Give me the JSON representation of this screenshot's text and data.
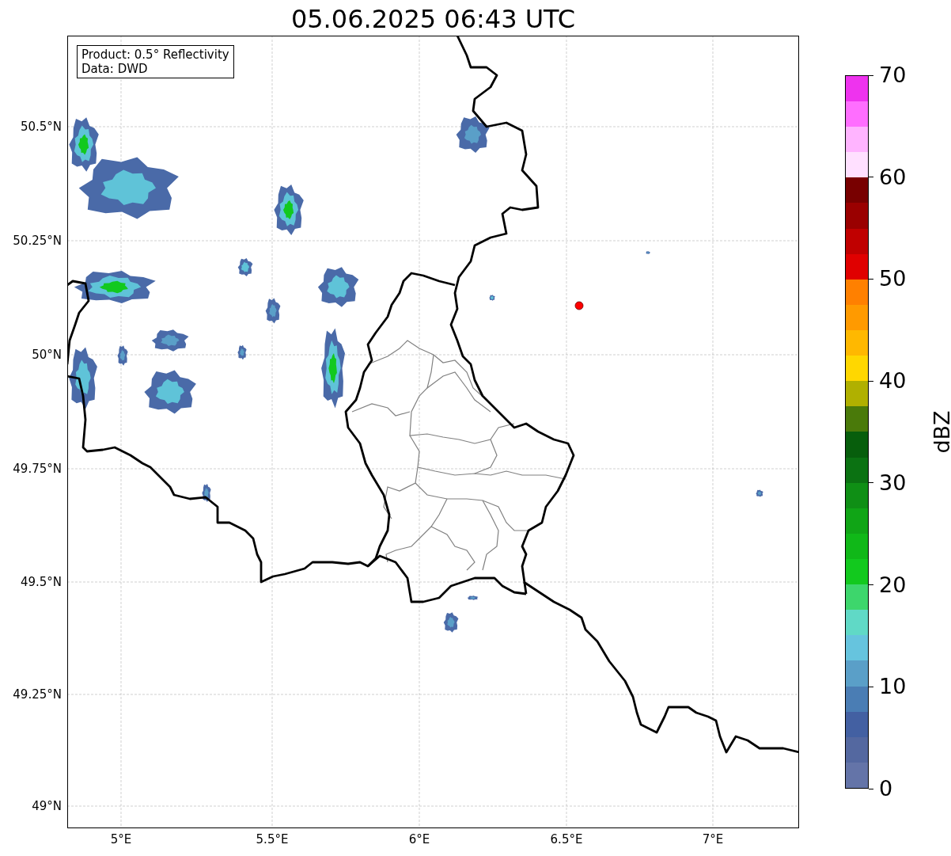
{
  "title": "05.06.2025 06:43 UTC",
  "info_box": {
    "lines": [
      "Product: 0.5° Reflectivity",
      "Data: DWD"
    ]
  },
  "map": {
    "latitude_labels": [
      "50.5°N",
      "50.25°N",
      "50°N",
      "49.75°N",
      "49.5°N",
      "49.25°N",
      "49°N"
    ],
    "longitude_labels": [
      "5°E",
      "5.5°E",
      "6°E",
      "6.5°E",
      "7°E"
    ]
  },
  "colorbar": {
    "label": "dBZ",
    "ticks": [
      "70",
      "60",
      "50",
      "40",
      "30",
      "20",
      "10",
      "0"
    ],
    "segments": [
      {
        "color": "#6474a8"
      },
      {
        "color": "#5468a0"
      },
      {
        "color": "#4360a2"
      },
      {
        "color": "#4a7db4"
      },
      {
        "color": "#5a9fc8"
      },
      {
        "color": "#66c4de"
      },
      {
        "color": "#60d9c6"
      },
      {
        "color": "#3dd66c"
      },
      {
        "color": "#12c91e"
      },
      {
        "color": "#10b818"
      },
      {
        "color": "#10a516"
      },
      {
        "color": "#0f8f15"
      },
      {
        "color": "#0b7212"
      },
      {
        "color": "#075e0c"
      },
      {
        "color": "#4a7a0a"
      },
      {
        "color": "#b0b000"
      },
      {
        "color": "#ffd700"
      },
      {
        "color": "#ffb800"
      },
      {
        "color": "#ff9a00"
      },
      {
        "color": "#ff8000"
      },
      {
        "color": "#e00000"
      },
      {
        "color": "#c00000"
      },
      {
        "color": "#9a0000"
      },
      {
        "color": "#780000"
      },
      {
        "color": "#ffe0ff"
      },
      {
        "color": "#ffb4ff"
      },
      {
        "color": "#ff6eff"
      },
      {
        "color": "#ee33ee"
      }
    ]
  }
}
